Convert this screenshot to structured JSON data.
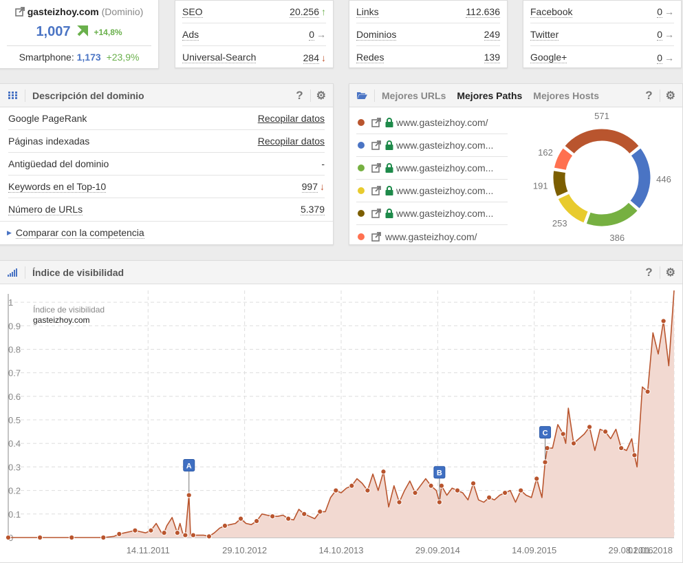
{
  "domain_card": {
    "domain": "gasteizhoy.com",
    "kind": "(Dominio)",
    "value": "1,007",
    "change": "+14,8%",
    "trend": "up",
    "smartphone_label": "Smartphone:",
    "smartphone_value": "1,173",
    "smartphone_change": "+23,9%"
  },
  "seo_card": {
    "rows": [
      {
        "label": "SEO",
        "value": "20.256",
        "arrow": "↑",
        "trend": "up"
      },
      {
        "label": "Ads",
        "value": "0",
        "arrow": "→",
        "trend": "right"
      },
      {
        "label": "Universal-Search",
        "value": "284",
        "arrow": "↓",
        "trend": "down"
      }
    ]
  },
  "links_card": {
    "rows": [
      {
        "label": "Links",
        "value": "112.636"
      },
      {
        "label": "Dominios",
        "value": "249"
      },
      {
        "label": "Redes",
        "value": "139"
      }
    ]
  },
  "social_card": {
    "rows": [
      {
        "label": "Facebook",
        "value": "0",
        "arrow": "→"
      },
      {
        "label": "Twitter",
        "value": "0",
        "arrow": "→"
      },
      {
        "label": "Google+",
        "value": "0",
        "arrow": "→"
      }
    ]
  },
  "description_panel": {
    "title": "Descripción del dominio",
    "help": "?",
    "rows": [
      {
        "label": "Google PageRank",
        "value": "Recopilar datos",
        "type": "link"
      },
      {
        "label": "Páginas indexadas",
        "value": "Recopilar datos",
        "type": "link"
      },
      {
        "label": "Antigüedad del dominio",
        "value": "-",
        "type": "text"
      },
      {
        "label": "Keywords en el Top-10",
        "value": "997",
        "arrow": "↓",
        "type": "dotted"
      },
      {
        "label": "Número de URLs",
        "value": "5.379",
        "type": "dotted"
      }
    ],
    "compare_label": "Comparar con la competencia"
  },
  "paths_panel": {
    "tabs": [
      {
        "label": "Mejores URLs",
        "active": false
      },
      {
        "label": "Mejores Paths",
        "active": true
      },
      {
        "label": "Mejores Hosts",
        "active": false
      }
    ],
    "help": "?",
    "items": [
      {
        "url": "www.gasteizhoy.com/",
        "color": "#b9552e",
        "secure": true,
        "value": 571
      },
      {
        "url": "www.gasteizhoy.com...",
        "color": "#4a74c4",
        "secure": true,
        "value": 446
      },
      {
        "url": "www.gasteizhoy.com...",
        "color": "#76b041",
        "secure": true,
        "value": 386
      },
      {
        "url": "www.gasteizhoy.com...",
        "color": "#e8cb2e",
        "secure": true,
        "value": 253
      },
      {
        "url": "www.gasteizhoy.com...",
        "color": "#7c5e00",
        "secure": true,
        "value": 191
      },
      {
        "url": "www.gasteizhoy.com/",
        "color": "#ff7150",
        "secure": false,
        "value": 162
      }
    ]
  },
  "visibility_panel": {
    "title": "Índice de visibilidad",
    "help": "?"
  },
  "chart_data": {
    "type": "area",
    "title": "Índice de visibilidad",
    "legend": {
      "title": "Índice de visibilidad",
      "series": "gasteizhoy.com",
      "placement": "top-left"
    },
    "xlabel": "",
    "ylabel": "",
    "ylim": [
      0,
      1.05
    ],
    "yticks": [
      0,
      0.1,
      0.2,
      0.3,
      0.4,
      0.5,
      0.6,
      0.7,
      0.8,
      0.9,
      1
    ],
    "ytick_labels": [
      "0",
      "0.1",
      "0.2",
      "0.3",
      "0.4",
      "0.5",
      "0.6",
      "0.7",
      "0.8",
      "0.9",
      "1"
    ],
    "xtick_labels": [
      "14.11.2011",
      "29.10.2012",
      "14.10.2013",
      "29.09.2014",
      "14.09.2015",
      "29.08.2016",
      "01.01.2018"
    ],
    "xtick_positions": [
      0.21,
      0.355,
      0.5,
      0.645,
      0.79,
      0.935,
      1.0
    ],
    "grid": true,
    "color": "#b9552e",
    "fill": "#f2d9d1",
    "annotations": [
      {
        "label": "A",
        "t": 0.342,
        "value": 0.18
      },
      {
        "label": "B",
        "t": 0.816,
        "value": 0.15
      },
      {
        "label": "C",
        "t": 1.016,
        "value": 0.32
      }
    ],
    "series": [
      {
        "name": "gasteizhoy.com",
        "x": [
          0,
          0.02,
          0.04,
          0.06,
          0.08,
          0.1,
          0.12,
          0.14,
          0.16,
          0.18,
          0.2,
          0.205,
          0.21,
          0.22,
          0.23,
          0.24,
          0.25,
          0.26,
          0.27,
          0.28,
          0.29,
          0.295,
          0.3,
          0.31,
          0.32,
          0.325,
          0.33,
          0.335,
          0.342,
          0.345,
          0.35,
          0.36,
          0.37,
          0.38,
          0.39,
          0.4,
          0.41,
          0.42,
          0.43,
          0.44,
          0.45,
          0.46,
          0.47,
          0.48,
          0.49,
          0.5,
          0.51,
          0.52,
          0.53,
          0.54,
          0.55,
          0.56,
          0.57,
          0.58,
          0.59,
          0.6,
          0.61,
          0.62,
          0.63,
          0.64,
          0.65,
          0.66,
          0.67,
          0.68,
          0.69,
          0.7,
          0.71,
          0.72,
          0.73,
          0.74,
          0.75,
          0.76,
          0.77,
          0.78,
          0.79,
          0.8,
          0.81,
          0.816,
          0.82,
          0.83,
          0.84,
          0.85,
          0.86,
          0.87,
          0.88,
          0.89,
          0.9,
          0.91,
          0.92,
          0.93,
          0.94,
          0.95,
          0.96,
          0.97,
          0.98,
          0.99,
          1.0,
          1.01,
          1.016,
          1.02,
          1.03,
          1.04,
          1.05,
          1.055,
          1.06,
          1.07,
          1.08,
          1.09,
          1.1,
          1.11,
          1.12,
          1.13,
          1.14,
          1.15,
          1.16,
          1.17,
          1.18,
          1.185,
          1.19,
          1.2,
          1.21,
          1.22,
          1.23,
          1.24,
          1.25,
          1.26
        ],
        "values": [
          0,
          0,
          0,
          0,
          0,
          0,
          0,
          0,
          0,
          0,
          0.005,
          0.01,
          0.015,
          0.02,
          0.025,
          0.03,
          0.025,
          0.02,
          0.03,
          0.06,
          0.02,
          0.02,
          0.05,
          0.085,
          0.02,
          0.06,
          0.02,
          0.01,
          0.18,
          0.01,
          0.01,
          0.01,
          0.01,
          0.005,
          0.02,
          0.04,
          0.05,
          0.055,
          0.06,
          0.08,
          0.06,
          0.055,
          0.07,
          0.1,
          0.095,
          0.09,
          0.09,
          0.095,
          0.08,
          0.075,
          0.12,
          0.1,
          0.09,
          0.08,
          0.11,
          0.11,
          0.17,
          0.2,
          0.19,
          0.21,
          0.22,
          0.25,
          0.23,
          0.2,
          0.27,
          0.2,
          0.28,
          0.13,
          0.22,
          0.15,
          0.2,
          0.24,
          0.19,
          0.22,
          0.25,
          0.22,
          0.2,
          0.15,
          0.22,
          0.18,
          0.21,
          0.2,
          0.19,
          0.16,
          0.23,
          0.16,
          0.15,
          0.17,
          0.16,
          0.18,
          0.19,
          0.2,
          0.15,
          0.2,
          0.18,
          0.17,
          0.25,
          0.17,
          0.32,
          0.38,
          0.38,
          0.48,
          0.44,
          0.4,
          0.55,
          0.4,
          0.42,
          0.44,
          0.47,
          0.37,
          0.46,
          0.45,
          0.42,
          0.46,
          0.38,
          0.37,
          0.42,
          0.35,
          0.3,
          0.64,
          0.62,
          0.87,
          0.78,
          0.92,
          0.73,
          1.05,
          1.01
        ]
      }
    ]
  }
}
